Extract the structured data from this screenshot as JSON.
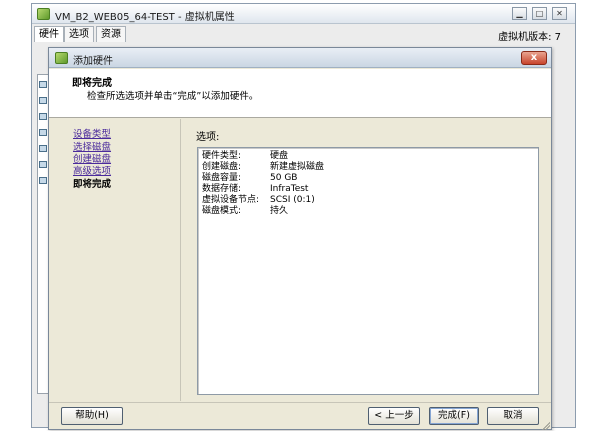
{
  "main_window": {
    "title": "VM_B2_WEB05_64-TEST - 虚拟机属性",
    "tabs": [
      {
        "label": "硬件"
      },
      {
        "label": "选项"
      },
      {
        "label": "资源"
      }
    ],
    "vm_version": "虚拟机版本: 7"
  },
  "dialog": {
    "title": "添加硬件",
    "close_label": "x",
    "header": {
      "title": "即将完成",
      "description": "检查所选选项并单击“完成”以添加硬件。"
    },
    "steps": [
      {
        "label": "设备类型",
        "state": "done"
      },
      {
        "label": "选择磁盘",
        "state": "done"
      },
      {
        "label": "创建磁盘",
        "state": "done"
      },
      {
        "label": "高级选项",
        "state": "done"
      },
      {
        "label": "即将完成",
        "state": "current"
      }
    ],
    "options_label": "选项:",
    "summary": [
      {
        "key": "硬件类型:",
        "value": "硬盘"
      },
      {
        "key": "创建磁盘:",
        "value": "新建虚拟磁盘"
      },
      {
        "key": "磁盘容量:",
        "value": "50 GB"
      },
      {
        "key": "数据存储:",
        "value": "InfraTest"
      },
      {
        "key": "虚拟设备节点:",
        "value": "SCSI (0:1)"
      },
      {
        "key": "磁盘模式:",
        "value": "持久"
      }
    ],
    "buttons": {
      "help": "帮助(H)",
      "back": "< 上一步",
      "finish": "完成(F)",
      "cancel": "取消"
    }
  }
}
